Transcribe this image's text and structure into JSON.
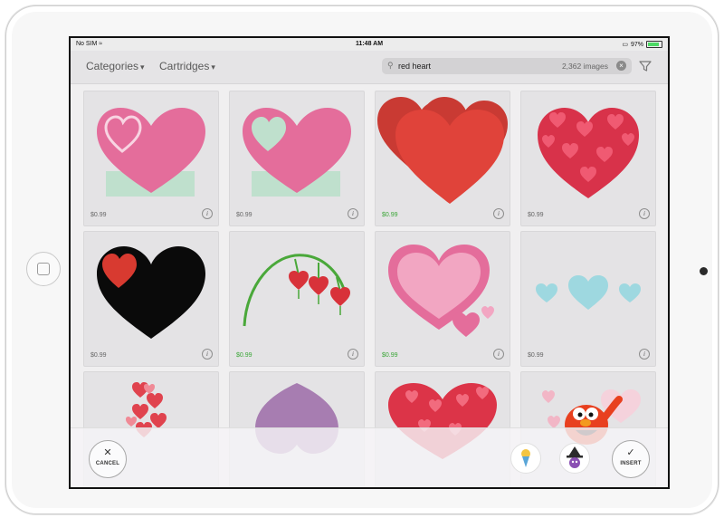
{
  "status_bar": {
    "carrier": "No SIM",
    "wifi_icon": "wifi-icon",
    "time": "11:48 AM",
    "battery_percent": "97%",
    "airplay_icon": "airplay-icon"
  },
  "nav": {
    "categories_label": "Categories",
    "cartridges_label": "Cartridges",
    "caret": "▾",
    "search_value": "red heart",
    "search_count": "2,362 images",
    "search_icon": "search-icon",
    "clear_icon": "clear-icon",
    "filter_icon": "filter-icon"
  },
  "tiles": [
    {
      "price": "$0.99",
      "price_color": "gray",
      "art": "pink heart with outline heart on green rectangle"
    },
    {
      "price": "$0.99",
      "price_color": "gray",
      "art": "pink heart with mint heart on green rectangle"
    },
    {
      "price": "$0.99",
      "price_color": "green",
      "art": "layered red hearts"
    },
    {
      "price": "$0.99",
      "price_color": "gray",
      "art": "heart made of small red hearts"
    },
    {
      "price": "$0.99",
      "price_color": "gray",
      "art": "black heart with red heart"
    },
    {
      "price": "$0.99",
      "price_color": "green",
      "art": "bleeding heart flower stem"
    },
    {
      "price": "$0.99",
      "price_color": "green",
      "art": "pink heart with small hearts"
    },
    {
      "price": "$0.99",
      "price_color": "gray",
      "art": "three light blue hearts"
    },
    {
      "price": "",
      "price_color": "gray",
      "art": "stack of small red hearts"
    },
    {
      "price": "",
      "price_color": "gray",
      "art": "purple textured heart"
    },
    {
      "price": "",
      "price_color": "gray",
      "art": "cluster of red hearts"
    },
    {
      "price": "",
      "price_color": "gray",
      "art": "red character holding a pink heart"
    }
  ],
  "info_glyph": "i",
  "bottom_bar": {
    "cancel_label": "CANCEL",
    "cancel_glyph": "✕",
    "insert_label": "INSERT",
    "insert_glyph": "✓"
  },
  "colors": {
    "pink": "#e46d9b",
    "red": "#e0433a",
    "green_price": "#3aa637",
    "mint": "#bfe0cd",
    "light_blue": "#9ed8e0"
  }
}
